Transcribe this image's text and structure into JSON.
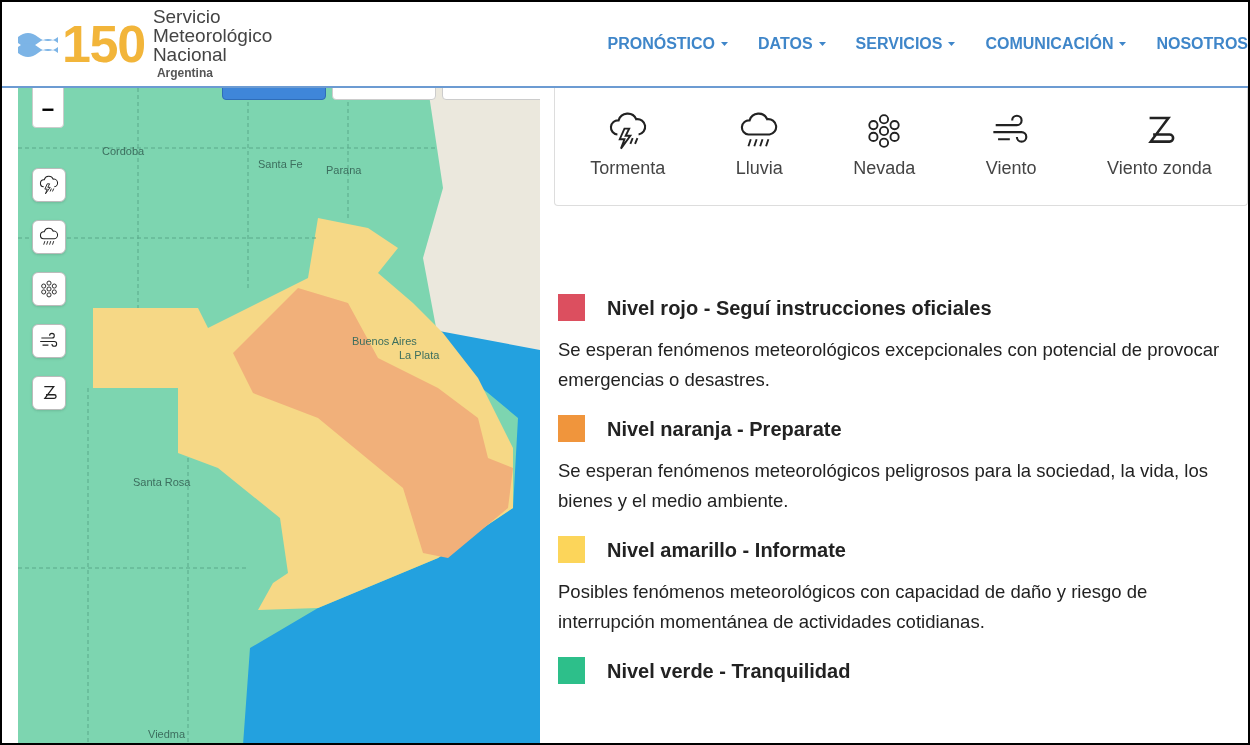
{
  "header": {
    "logo_number": "150",
    "logo_lines": [
      "Servicio",
      "Meteorológico",
      "Nacional"
    ],
    "logo_country": "Argentina"
  },
  "nav": [
    {
      "label": "PRONÓSTICO",
      "dropdown": true
    },
    {
      "label": "DATOS",
      "dropdown": true
    },
    {
      "label": "SERVICIOS",
      "dropdown": true
    },
    {
      "label": "COMUNICACIÓN",
      "dropdown": true
    },
    {
      "label": "NOSOTROS",
      "dropdown": false
    }
  ],
  "map": {
    "zoom": [
      "−"
    ],
    "top_tabs": [
      {
        "selected": true
      },
      {
        "selected": false
      },
      {
        "selected": false
      }
    ],
    "layers": [
      {
        "kind": "storm"
      },
      {
        "kind": "rain"
      },
      {
        "kind": "snow"
      },
      {
        "kind": "wind"
      },
      {
        "kind": "zonda"
      }
    ],
    "cities": [
      {
        "name": "Cordoba"
      },
      {
        "name": "Santa Fe"
      },
      {
        "name": "Parana"
      },
      {
        "name": "Buenos Aires"
      },
      {
        "name": "La Plata"
      },
      {
        "name": "Santa Rosa"
      },
      {
        "name": "Viedma"
      }
    ]
  },
  "phenomena": [
    {
      "kind": "storm",
      "label": "Tormenta"
    },
    {
      "kind": "rain",
      "label": "Lluvia"
    },
    {
      "kind": "snow",
      "label": "Nevada"
    },
    {
      "kind": "wind",
      "label": "Viento"
    },
    {
      "kind": "zonda",
      "label": "Viento zonda"
    }
  ],
  "legend": [
    {
      "color": "#dc4f5f",
      "title": "Nivel rojo - Seguí instrucciones oficiales",
      "text": "Se esperan fenómenos meteorológicos excepcionales con potencial de provocar emergencias o desastres."
    },
    {
      "color": "#f0953c",
      "title": "Nivel naranja - Preparate",
      "text": "Se esperan fenómenos meteorológicos peligrosos para la sociedad, la vida, los bienes y el medio ambiente."
    },
    {
      "color": "#fcd55a",
      "title": "Nivel amarillo - Informate",
      "text": "Posibles fenómenos meteorológicos con capacidad de daño y riesgo de interrupción momentánea de actividades cotidianas."
    },
    {
      "color": "#2dbf8a",
      "title": "Nivel verde - Tranquilidad"
    }
  ]
}
